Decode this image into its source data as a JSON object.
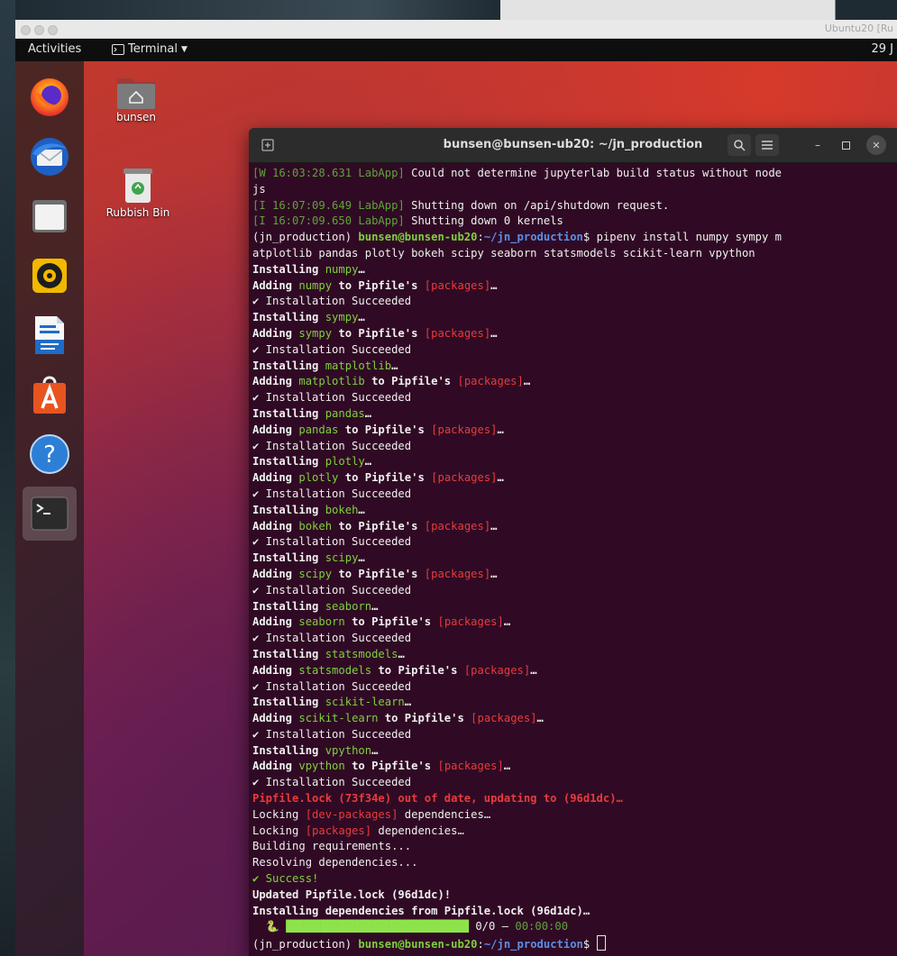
{
  "host": {
    "window_title": "Ubuntu20 [Ru"
  },
  "topbar": {
    "activities": "Activities",
    "app_menu": "Terminal",
    "clock": "29 J"
  },
  "desktop": {
    "home_label": "bunsen",
    "trash_label": "Rubbish Bin"
  },
  "dock": {
    "items": [
      "firefox-icon",
      "thunderbird-icon",
      "files-icon",
      "rhythmbox-icon",
      "writer-icon",
      "software-icon",
      "help-icon",
      "terminal-icon"
    ]
  },
  "terminal": {
    "title": "bunsen@bunsen-ub20: ~/jn_production",
    "lines": [
      {
        "segments": [
          {
            "t": "[W 16:03:28.631 LabApp]",
            "c": "dim"
          },
          {
            "t": " Could not determine jupyterlab build status without node",
            "c": ""
          }
        ]
      },
      {
        "segments": [
          {
            "t": "js",
            "c": ""
          }
        ]
      },
      {
        "segments": [
          {
            "t": "[I 16:07:09.649 LabApp]",
            "c": "dim"
          },
          {
            "t": " Shutting down on /api/shutdown request.",
            "c": ""
          }
        ]
      },
      {
        "segments": [
          {
            "t": "[I 16:07:09.650 LabApp]",
            "c": "dim"
          },
          {
            "t": " Shutting down 0 kernels",
            "c": ""
          }
        ]
      },
      {
        "segments": [
          {
            "t": "(jn_production) ",
            "c": ""
          },
          {
            "t": "bunsen@bunsen-ub20",
            "c": "grn b"
          },
          {
            "t": ":",
            "c": ""
          },
          {
            "t": "~/jn_production",
            "c": "path"
          },
          {
            "t": "$ pipenv install numpy sympy m",
            "c": ""
          }
        ]
      },
      {
        "segments": [
          {
            "t": "atplotlib pandas plotly bokeh scipy seaborn statsmodels scikit-learn vpython",
            "c": ""
          }
        ]
      },
      {
        "segments": [
          {
            "t": "Installing ",
            "c": "b"
          },
          {
            "t": "numpy",
            "c": "grn"
          },
          {
            "t": "…",
            "c": "b"
          }
        ]
      },
      {
        "segments": [
          {
            "t": "Adding ",
            "c": "b"
          },
          {
            "t": "numpy",
            "c": "grn"
          },
          {
            "t": " to Pipfile's ",
            "c": "b"
          },
          {
            "t": "[packages]",
            "c": "red"
          },
          {
            "t": "…",
            "c": "b"
          }
        ]
      },
      {
        "segments": [
          {
            "t": "✔ Installation Succeeded",
            "c": ""
          }
        ]
      },
      {
        "segments": [
          {
            "t": "Installing ",
            "c": "b"
          },
          {
            "t": "sympy",
            "c": "grn"
          },
          {
            "t": "…",
            "c": "b"
          }
        ]
      },
      {
        "segments": [
          {
            "t": "Adding ",
            "c": "b"
          },
          {
            "t": "sympy",
            "c": "grn"
          },
          {
            "t": " to Pipfile's ",
            "c": "b"
          },
          {
            "t": "[packages]",
            "c": "red"
          },
          {
            "t": "…",
            "c": "b"
          }
        ]
      },
      {
        "segments": [
          {
            "t": "✔ Installation Succeeded",
            "c": ""
          }
        ]
      },
      {
        "segments": [
          {
            "t": "Installing ",
            "c": "b"
          },
          {
            "t": "matplotlib",
            "c": "grn"
          },
          {
            "t": "…",
            "c": "b"
          }
        ]
      },
      {
        "segments": [
          {
            "t": "Adding ",
            "c": "b"
          },
          {
            "t": "matplotlib",
            "c": "grn"
          },
          {
            "t": " to Pipfile's ",
            "c": "b"
          },
          {
            "t": "[packages]",
            "c": "red"
          },
          {
            "t": "…",
            "c": "b"
          }
        ]
      },
      {
        "segments": [
          {
            "t": "✔ Installation Succeeded",
            "c": ""
          }
        ]
      },
      {
        "segments": [
          {
            "t": "Installing ",
            "c": "b"
          },
          {
            "t": "pandas",
            "c": "grn"
          },
          {
            "t": "…",
            "c": "b"
          }
        ]
      },
      {
        "segments": [
          {
            "t": "Adding ",
            "c": "b"
          },
          {
            "t": "pandas",
            "c": "grn"
          },
          {
            "t": " to Pipfile's ",
            "c": "b"
          },
          {
            "t": "[packages]",
            "c": "red"
          },
          {
            "t": "…",
            "c": "b"
          }
        ]
      },
      {
        "segments": [
          {
            "t": "✔ Installation Succeeded",
            "c": ""
          }
        ]
      },
      {
        "segments": [
          {
            "t": "Installing ",
            "c": "b"
          },
          {
            "t": "plotly",
            "c": "grn"
          },
          {
            "t": "…",
            "c": "b"
          }
        ]
      },
      {
        "segments": [
          {
            "t": "Adding ",
            "c": "b"
          },
          {
            "t": "plotly",
            "c": "grn"
          },
          {
            "t": " to Pipfile's ",
            "c": "b"
          },
          {
            "t": "[packages]",
            "c": "red"
          },
          {
            "t": "…",
            "c": "b"
          }
        ]
      },
      {
        "segments": [
          {
            "t": "✔ Installation Succeeded",
            "c": ""
          }
        ]
      },
      {
        "segments": [
          {
            "t": "Installing ",
            "c": "b"
          },
          {
            "t": "bokeh",
            "c": "grn"
          },
          {
            "t": "…",
            "c": "b"
          }
        ]
      },
      {
        "segments": [
          {
            "t": "Adding ",
            "c": "b"
          },
          {
            "t": "bokeh",
            "c": "grn"
          },
          {
            "t": " to Pipfile's ",
            "c": "b"
          },
          {
            "t": "[packages]",
            "c": "red"
          },
          {
            "t": "…",
            "c": "b"
          }
        ]
      },
      {
        "segments": [
          {
            "t": "✔ Installation Succeeded",
            "c": ""
          }
        ]
      },
      {
        "segments": [
          {
            "t": "Installing ",
            "c": "b"
          },
          {
            "t": "scipy",
            "c": "grn"
          },
          {
            "t": "…",
            "c": "b"
          }
        ]
      },
      {
        "segments": [
          {
            "t": "Adding ",
            "c": "b"
          },
          {
            "t": "scipy",
            "c": "grn"
          },
          {
            "t": " to Pipfile's ",
            "c": "b"
          },
          {
            "t": "[packages]",
            "c": "red"
          },
          {
            "t": "…",
            "c": "b"
          }
        ]
      },
      {
        "segments": [
          {
            "t": "✔ Installation Succeeded",
            "c": ""
          }
        ]
      },
      {
        "segments": [
          {
            "t": "Installing ",
            "c": "b"
          },
          {
            "t": "seaborn",
            "c": "grn"
          },
          {
            "t": "…",
            "c": "b"
          }
        ]
      },
      {
        "segments": [
          {
            "t": "Adding ",
            "c": "b"
          },
          {
            "t": "seaborn",
            "c": "grn"
          },
          {
            "t": " to Pipfile's ",
            "c": "b"
          },
          {
            "t": "[packages]",
            "c": "red"
          },
          {
            "t": "…",
            "c": "b"
          }
        ]
      },
      {
        "segments": [
          {
            "t": "✔ Installation Succeeded",
            "c": ""
          }
        ]
      },
      {
        "segments": [
          {
            "t": "Installing ",
            "c": "b"
          },
          {
            "t": "statsmodels",
            "c": "grn"
          },
          {
            "t": "…",
            "c": "b"
          }
        ]
      },
      {
        "segments": [
          {
            "t": "Adding ",
            "c": "b"
          },
          {
            "t": "statsmodels",
            "c": "grn"
          },
          {
            "t": " to Pipfile's ",
            "c": "b"
          },
          {
            "t": "[packages]",
            "c": "red"
          },
          {
            "t": "…",
            "c": "b"
          }
        ]
      },
      {
        "segments": [
          {
            "t": "✔ Installation Succeeded",
            "c": ""
          }
        ]
      },
      {
        "segments": [
          {
            "t": "Installing ",
            "c": "b"
          },
          {
            "t": "scikit-learn",
            "c": "grn"
          },
          {
            "t": "…",
            "c": "b"
          }
        ]
      },
      {
        "segments": [
          {
            "t": "Adding ",
            "c": "b"
          },
          {
            "t": "scikit-learn",
            "c": "grn"
          },
          {
            "t": " to Pipfile's ",
            "c": "b"
          },
          {
            "t": "[packages]",
            "c": "red"
          },
          {
            "t": "…",
            "c": "b"
          }
        ]
      },
      {
        "segments": [
          {
            "t": "✔ Installation Succeeded",
            "c": ""
          }
        ]
      },
      {
        "segments": [
          {
            "t": "Installing ",
            "c": "b"
          },
          {
            "t": "vpython",
            "c": "grn"
          },
          {
            "t": "…",
            "c": "b"
          }
        ]
      },
      {
        "segments": [
          {
            "t": "Adding ",
            "c": "b"
          },
          {
            "t": "vpython",
            "c": "grn"
          },
          {
            "t": " to Pipfile's ",
            "c": "b"
          },
          {
            "t": "[packages]",
            "c": "red"
          },
          {
            "t": "…",
            "c": "b"
          }
        ]
      },
      {
        "segments": [
          {
            "t": "✔ Installation Succeeded",
            "c": ""
          }
        ]
      },
      {
        "segments": [
          {
            "t": "Pipfile.lock (73f34e) out of date, updating to (96d1dc)…",
            "c": "red b"
          }
        ]
      },
      {
        "segments": [
          {
            "t": "Locking ",
            "c": ""
          },
          {
            "t": "[dev-packages]",
            "c": "red"
          },
          {
            "t": " dependencies…",
            "c": ""
          }
        ]
      },
      {
        "segments": [
          {
            "t": "Locking ",
            "c": ""
          },
          {
            "t": "[packages]",
            "c": "red"
          },
          {
            "t": " dependencies…",
            "c": ""
          }
        ]
      },
      {
        "segments": [
          {
            "t": "Building requirements...",
            "c": ""
          }
        ]
      },
      {
        "segments": [
          {
            "t": "Resolving dependencies...",
            "c": ""
          }
        ]
      },
      {
        "segments": [
          {
            "t": "✔ Success!",
            "c": "grn"
          }
        ]
      },
      {
        "segments": [
          {
            "t": "Updated Pipfile.lock (96d1dc)!",
            "c": "b"
          }
        ]
      },
      {
        "segments": [
          {
            "t": "Installing dependencies from Pipfile.lock (96d1dc)…",
            "c": "b"
          }
        ]
      },
      {
        "segments": [
          {
            "t": "  🐍 ",
            "c": ""
          },
          {
            "t": "▉▉▉▉▉▉▉▉▉▉▉▉▉▉▉▉▉▉▉▉▉▉▉▉▉▉▉▉▉▉▉▉",
            "c": "bar"
          },
          {
            "t": " 0/0 — ",
            "c": ""
          },
          {
            "t": "00:00:00",
            "c": "dim"
          }
        ]
      },
      {
        "segments": [
          {
            "t": "(jn_production) ",
            "c": ""
          },
          {
            "t": "bunsen@bunsen-ub20",
            "c": "grn b"
          },
          {
            "t": ":",
            "c": ""
          },
          {
            "t": "~/jn_production",
            "c": "path"
          },
          {
            "t": "$ ",
            "c": ""
          }
        ],
        "cursor": true
      }
    ]
  }
}
